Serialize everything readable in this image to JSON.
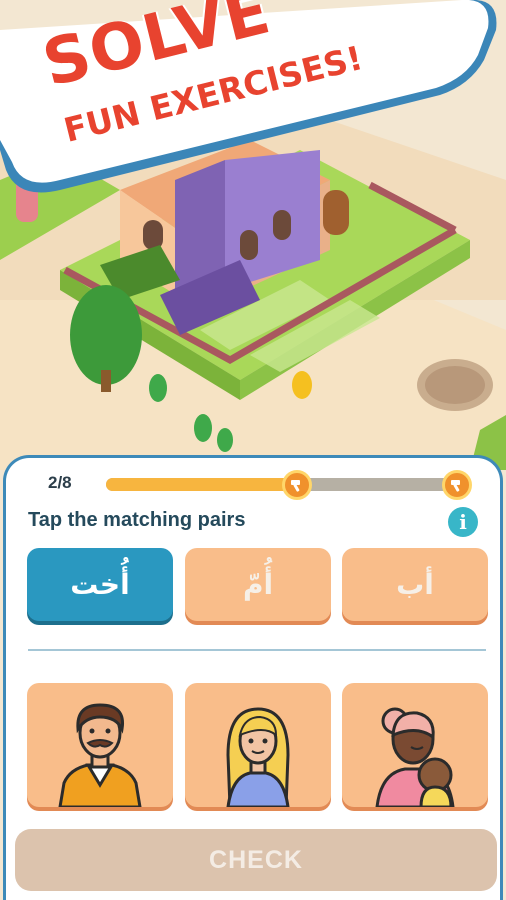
{
  "banner": {
    "line1": "SOLVE",
    "line2": "FUN EXERCISES!"
  },
  "exercise": {
    "progress_text": "2/8",
    "progress_fraction": 0.53,
    "milestone_icon": "hammer-icon",
    "instruction": "Tap the matching pairs",
    "info_label": "i",
    "words": [
      {
        "text": "أُخت",
        "state": "selected"
      },
      {
        "text": "أُمّ",
        "state": "normal"
      },
      {
        "text": "أب",
        "state": "normal"
      }
    ],
    "pictures": [
      {
        "icon": "father-icon"
      },
      {
        "icon": "sister-icon"
      },
      {
        "icon": "mother-icon"
      }
    ],
    "check_label": "CHECK"
  },
  "colors": {
    "selected": "#2a98c0",
    "card_button": "#f9bd8a",
    "check_disabled": "#dcc3ad",
    "banner_red": "#e8432f",
    "card_border": "#3d8ab9"
  }
}
